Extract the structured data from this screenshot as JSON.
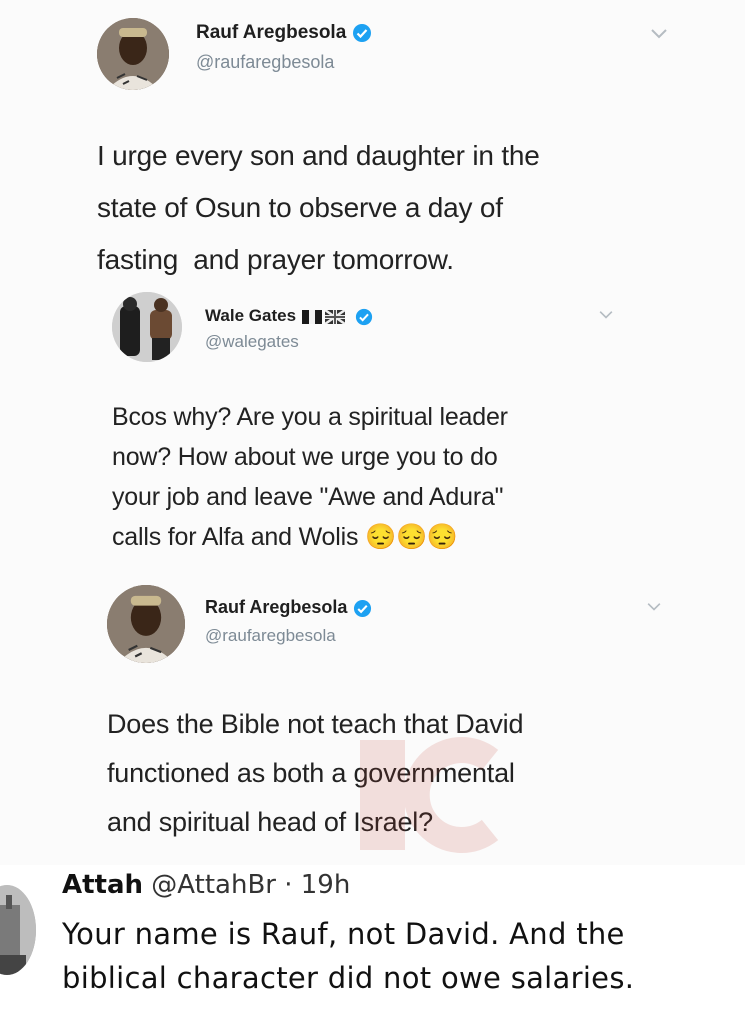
{
  "tweet1": {
    "display_name": "Rauf Aregbesola",
    "handle": "@raufaregbesola",
    "text_lines": [
      "I urge every son and daughter in the",
      "state of Osun to observe a day of",
      "fasting  and prayer tomorrow."
    ],
    "icons": {
      "verified": "verified-badge-icon",
      "menu": "chevron-down-icon"
    },
    "colors": {
      "verified": "#1da1f2",
      "handle": "#7d8a95"
    }
  },
  "tweet2": {
    "display_name": "Wale Gates",
    "handle": "@walegates",
    "text_lines": [
      "Bcos why? Are you a spiritual leader",
      "now? How about we urge you to do",
      "your job and leave \"Awe and Adura\"",
      "calls for Alfa and Wolis"
    ],
    "emoji": [
      "😔",
      "😔",
      "😔"
    ],
    "icons": {
      "flags": [
        "nigeria-flag-icon",
        "uk-flag-icon"
      ],
      "verified": "verified-badge-icon",
      "menu": "chevron-down-icon"
    }
  },
  "tweet3": {
    "display_name": "Rauf Aregbesola",
    "handle": "@raufaregbesola",
    "text_lines": [
      "Does the Bible not teach that David",
      "functioned as both a governmental",
      "and spiritual head of Israel?"
    ],
    "icons": {
      "verified": "verified-badge-icon",
      "menu": "chevron-down-icon"
    }
  },
  "reply": {
    "name": "Attah",
    "meta": " @AttahBr · 19h",
    "text_lines": [
      "Your name is Rauf, not David. And the",
      "biblical character did not owe salaries."
    ]
  }
}
